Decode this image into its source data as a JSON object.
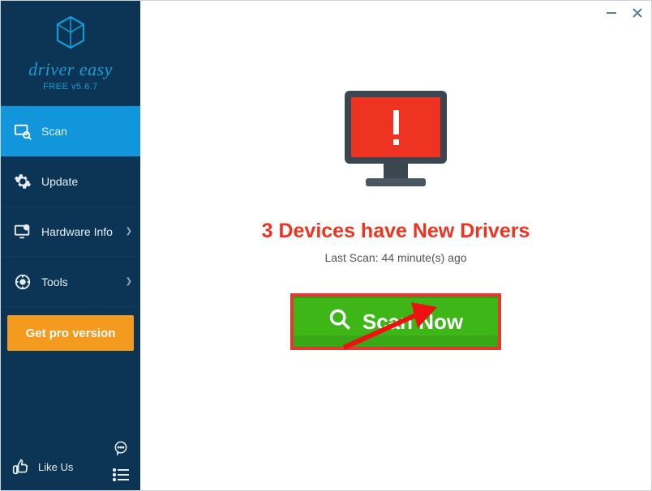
{
  "brand": {
    "name": "driver easy",
    "version": "FREE v5.6.7"
  },
  "sidebar": {
    "items": [
      {
        "label": "Scan"
      },
      {
        "label": "Update"
      },
      {
        "label": "Hardware Info"
      },
      {
        "label": "Tools"
      }
    ],
    "pro_label": "Get pro version",
    "like_label": "Like Us"
  },
  "main": {
    "headline": "3 Devices have New Drivers",
    "last_scan": "Last Scan: 44 minute(s) ago",
    "scan_button": "Scan Now"
  }
}
